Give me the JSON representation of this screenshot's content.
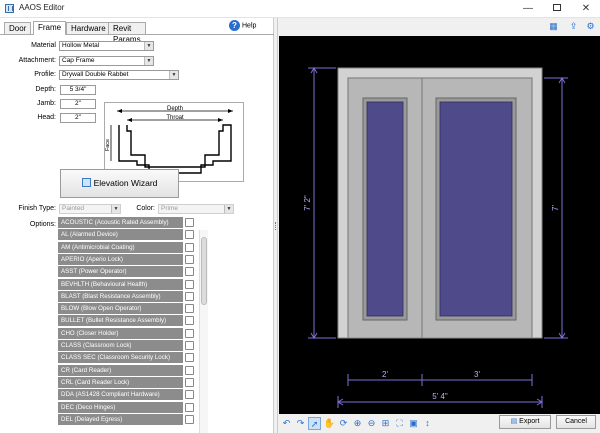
{
  "window": {
    "title": "AAOS Editor",
    "minimize": "—",
    "close": "✕"
  },
  "tabs": [
    "Door",
    "Frame",
    "Hardware",
    "Revit Params"
  ],
  "help_label": "Help",
  "form": {
    "material_label": "Material",
    "material_value": "Hollow Metal",
    "attachment_label": "Attachment:",
    "attachment_value": "Cap Frame",
    "profile_label": "Profile:",
    "profile_value": "Drywall Double Rabbet",
    "depth_label": "Depth:",
    "depth_value": "5 3/4\"",
    "jamb_label": "Jamb:",
    "jamb_value": "2\"",
    "head_label": "Head:",
    "head_value": "2\"",
    "finish_label": "Finish Type:",
    "finish_value": "Painted",
    "color_label": "Color:",
    "color_value": "Prime",
    "options_label": "Options:"
  },
  "diagram": {
    "depth": "Depth",
    "throat": "Throat",
    "face": "Face"
  },
  "wizard_label": "Elevation Wizard",
  "options": [
    "ACOUSTIC (Acoustic Rated Assembly)",
    "AL (Alarmed Device)",
    "AM (Antimicrobial Coating)",
    "APERIO (Aperio Lock)",
    "ASST (Power Operator)",
    "BEVHLTH (Behavioural Health)",
    "BLAST (Blast Resistance Assembly)",
    "BLOW (Blow Open Operator)",
    "BULLET (Bullet Resistance Assembly)",
    "CHO (Closer Holder)",
    "CLASS (Classroom Lock)",
    "CLASS SEC (Classroom Security Lock)",
    "CR (Card Reader)",
    "CRL (Card Reader Lock)",
    "DDA (AS1428 Compliant Hardware)",
    "DEC (Deco Hinges)",
    "DEL (Delayed Egress)"
  ],
  "dimensions": {
    "overall_height": "7' 2\"",
    "leaf_height": "7'",
    "left_leaf_width": "2'",
    "right_leaf_width": "3'",
    "overall_width": "5' 4\""
  },
  "buttons": {
    "export": "Export",
    "cancel": "Cancel"
  },
  "colors": {
    "viewer_bg": "#000000",
    "dimension_line": "#7b6fd6",
    "glass": "#4f4a8a",
    "frame": "#cfcfcf",
    "door": "#b9b9b9"
  }
}
